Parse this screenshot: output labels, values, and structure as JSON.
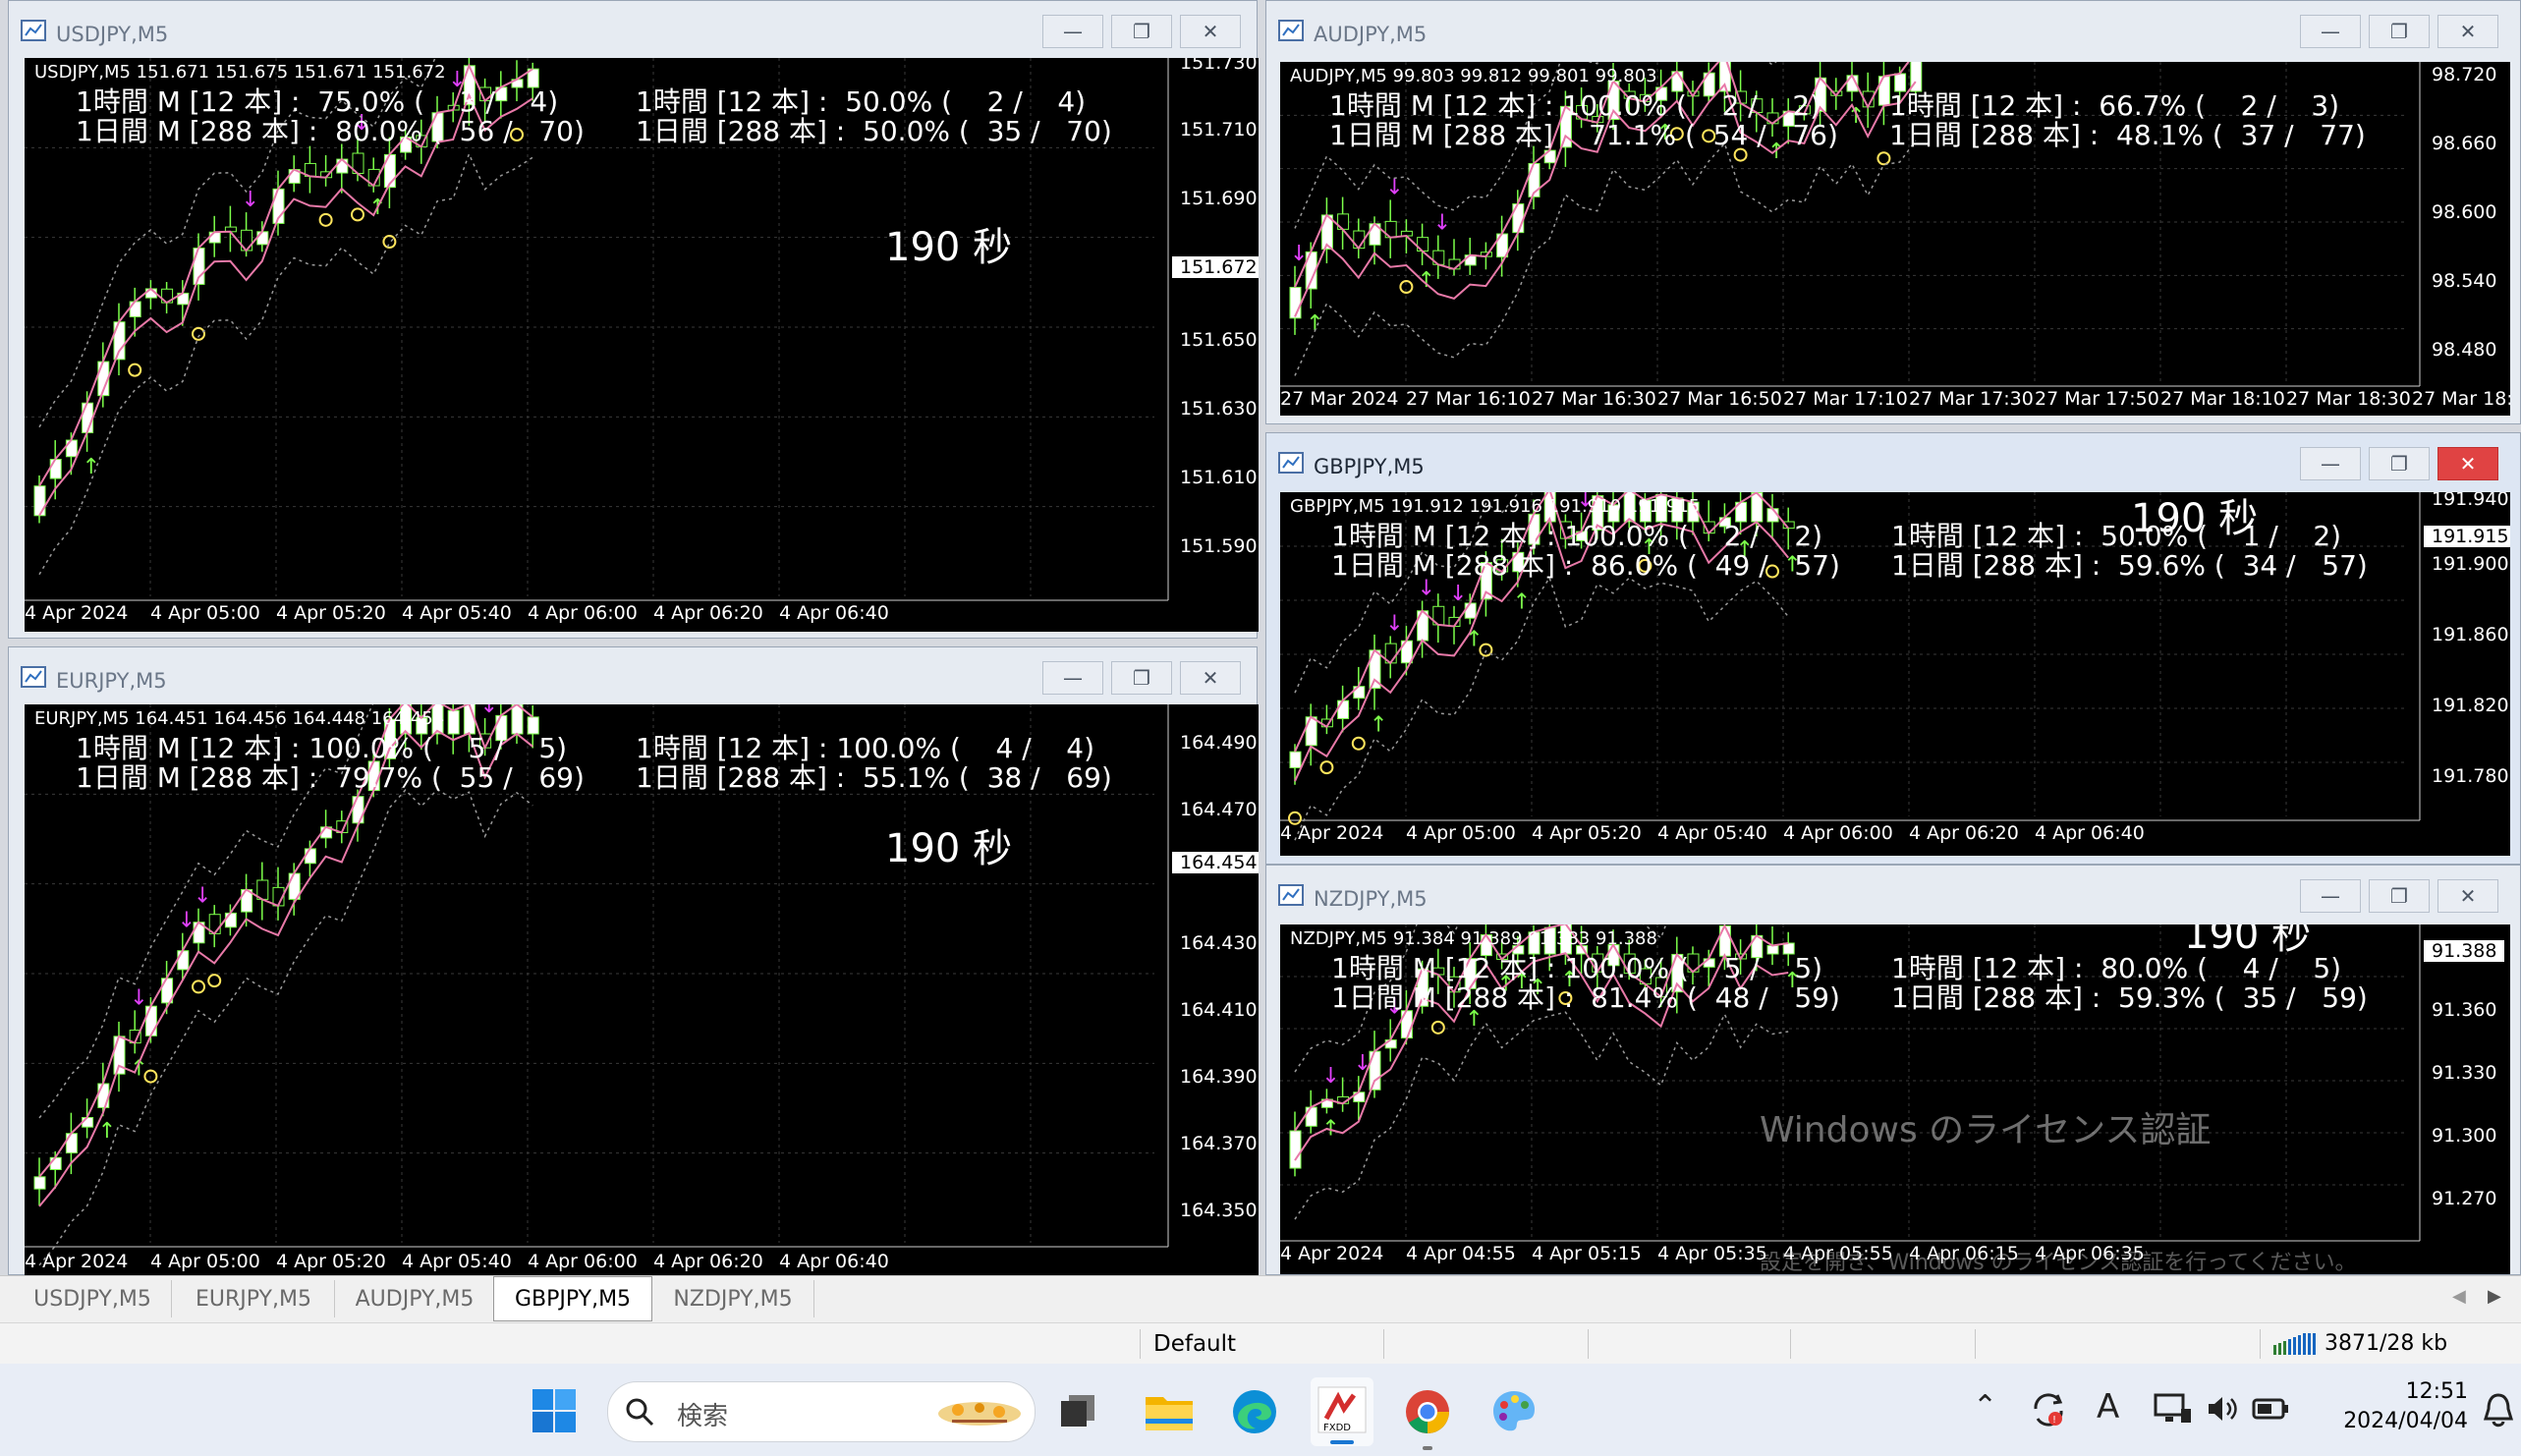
{
  "windows": [
    {
      "title": "USDJPY,M5",
      "symbol_line": "USDJPY,M5  151.671 151.675 151.671 151.672",
      "stat1": "1時間 M [12 本] :  75.0% (    3 /    4)",
      "stat2": "1日間 M [288 本] :  80.0% (  56 /   70)",
      "stat3": "1時間 [12 本] :  50.0% (    2 /    4)",
      "stat4": "1日間 [288 本] :  50.0% (  35 /   70)",
      "timer": "190 秒",
      "prices": [
        "151.730",
        "151.710",
        "151.690",
        "151.650",
        "151.630",
        "151.610",
        "151.590"
      ],
      "current": "151.672",
      "times": [
        "4 Apr 2024",
        "4 Apr 05:00",
        "4 Apr 05:20",
        "4 Apr 05:40",
        "4 Apr 06:00",
        "4 Apr 06:20",
        "4 Apr 06:40"
      ]
    },
    {
      "title": "EURJPY,M5",
      "symbol_line": "EURJPY,M5  164.451 164.456 164.448 164.454",
      "stat1": "1時間 M [12 本] : 100.0% (    5 /    5)",
      "stat2": "1日間 M [288 本] :  79.7% (  55 /   69)",
      "stat3": "1時間 [12 本] : 100.0% (    4 /    4)",
      "stat4": "1日間 [288 本] :  55.1% (  38 /   69)",
      "timer": "190 秒",
      "prices": [
        "164.490",
        "164.470",
        "164.450",
        "164.430",
        "164.410",
        "164.390",
        "164.370",
        "164.350"
      ],
      "current": "164.454",
      "times": [
        "4 Apr 2024",
        "4 Apr 05:00",
        "4 Apr 05:20",
        "4 Apr 05:40",
        "4 Apr 06:00",
        "4 Apr 06:20",
        "4 Apr 06:40"
      ]
    },
    {
      "title": "AUDJPY,M5",
      "symbol_line": "AUDJPY,M5  99.803 99.812 99.801 99.803",
      "stat1": "1時間 M [12 本] : 100.0% (    2 /    2)",
      "stat2": "1日間 M [288 本] :  71.1% (  54 /   76)",
      "stat3": "1時間 [12 本] :  66.7% (    2 /    3)",
      "stat4": "1日間 [288 本] :  48.1% (  37 /   77)",
      "timer": "",
      "prices": [
        "98.720",
        "98.660",
        "98.600",
        "98.540",
        "98.480"
      ],
      "current": "",
      "times": [
        "27 Mar 2024",
        "27 Mar 16:10",
        "27 Mar 16:30",
        "27 Mar 16:50",
        "27 Mar 17:10",
        "27 Mar 17:30",
        "27 Mar 17:50",
        "27 Mar 18:10",
        "27 Mar 18:30",
        "27 Mar 18:"
      ]
    },
    {
      "title": "GBPJPY,M5",
      "symbol_line": "GBPJPY,M5  191.912 191.916 191.910 191.915",
      "stat1": "1時間 M [12 本] : 100.0% (    2 /    2)",
      "stat2": "1日間 M [288 本] :  86.0% (  49 /   57)",
      "stat3": "1時間 [12 本] :  50.0% (    1 /    2)",
      "stat4": "1日間 [288 本] :  59.6% (  34 /   57)",
      "timer": "190 秒",
      "prices": [
        "191.940",
        "191.900",
        "191.860",
        "191.820",
        "191.780"
      ],
      "current": "191.915",
      "times": [
        "4 Apr 2024",
        "4 Apr 05:00",
        "4 Apr 05:20",
        "4 Apr 05:40",
        "4 Apr 06:00",
        "4 Apr 06:20",
        "4 Apr 06:40"
      ]
    },
    {
      "title": "NZDJPY,M5",
      "symbol_line": "NZDJPY,M5  91.384 91.389 91.383 91.388",
      "stat1": "1時間 M [12 本] : 100.0% (    5 /    5)",
      "stat2": "1日間 M [288 本] :  81.4% (  48 /   59)",
      "stat3": "1時間 [12 本] :  80.0% (    4 /    5)",
      "stat4": "1日間 [288 本] :  59.3% (  35 /   59)",
      "timer": "190 秒",
      "prices": [
        "91.360",
        "91.330",
        "91.300",
        "91.270"
      ],
      "current": "91.388",
      "times": [
        "4 Apr 2024",
        "4 Apr 04:55",
        "4 Apr 05:15",
        "4 Apr 05:35",
        "4 Apr 05:55",
        "4 Apr 06:15",
        "4 Apr 06:35"
      ]
    }
  ],
  "watermark": {
    "line1": "Windows のライセンス認証",
    "line2": "設定を開き、Windows のライセンス認証を行ってください。"
  },
  "tabs": [
    "USDJPY,M5",
    "EURJPY,M5",
    "AUDJPY,M5",
    "GBPJPY,M5",
    "NZDJPY,M5"
  ],
  "selected_tab": "GBPJPY,M5",
  "status": {
    "profile": "Default",
    "traffic": "3871/28 kb"
  },
  "taskbar": {
    "search_placeholder": "検索",
    "time": "12:51",
    "date": "2024/04/04"
  },
  "icons": [
    "window-minimize-icon",
    "window-maximize-icon",
    "window-close-icon",
    "windows-start-icon",
    "search-icon",
    "task-view-icon",
    "file-explorer-icon",
    "edge-icon",
    "fxdd-icon",
    "chrome-icon",
    "paint-icon",
    "chevron-up-icon",
    "sync-icon",
    "ime-icon",
    "network-icon",
    "volume-icon",
    "battery-icon",
    "notification-icon"
  ],
  "colors": {
    "chart_bg": "#000000",
    "ma_pink": "#e879a8",
    "ma_green": "#9be06a",
    "arrow_up": "#7cff4a",
    "arrow_down": "#e040fb",
    "circle": "#ffe45c",
    "close_active": "#e04343"
  }
}
